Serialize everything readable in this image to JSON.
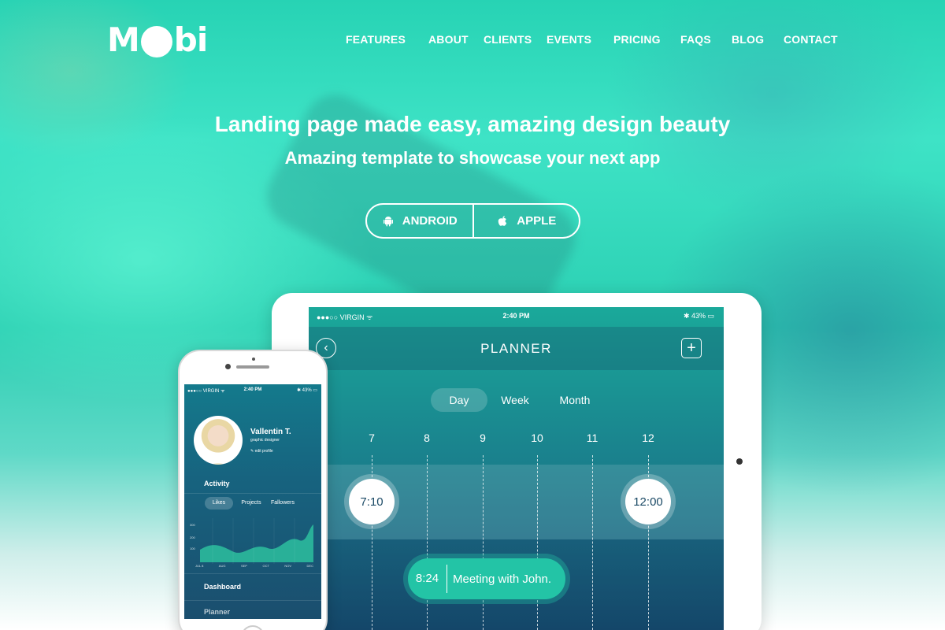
{
  "brand": {
    "logo_left": "M",
    "logo_right": "bi"
  },
  "nav": {
    "items": [
      "FEATURES",
      "ABOUT",
      "CLIENTS",
      "EVENTS",
      "PRICING",
      "FAQS",
      "BLOG",
      "CONTACT"
    ]
  },
  "hero": {
    "title": "Landing page made easy, amazing design beauty",
    "subtitle": "Amazing template to showcase your next app"
  },
  "buttons": {
    "android": "ANDROID",
    "apple": "APPLE"
  },
  "tablet": {
    "status": {
      "carrier": "●●●○○ VIRGIN ᯤ",
      "time": "2:40 PM",
      "battery": "✱ 43% ▭"
    },
    "header": {
      "title": "PLANNER",
      "back_icon": "chevron-left-icon",
      "add_icon": "plus-icon"
    },
    "segments": [
      "Day",
      "Week",
      "Month"
    ],
    "hours": [
      "7",
      "8",
      "9",
      "10",
      "11",
      "12"
    ],
    "events": {
      "start": "7:10",
      "end": "12:00",
      "meeting_time": "8:24",
      "meeting_text": "Meeting with John."
    }
  },
  "phone": {
    "status": {
      "carrier": "●●●○○ VIRGIN ᯤ",
      "time": "2:40 PM",
      "battery": "✱ 43% ▭"
    },
    "profile": {
      "name": "Vallentin T.",
      "role": "graphic designer",
      "edit": "✎ edit profile"
    },
    "activity_title": "Activity",
    "tabs": [
      "Likes",
      "Projects",
      "Fallowers"
    ],
    "chart_axis": [
      "JUL 8",
      "AUG",
      "SEP",
      "OCT",
      "NOV",
      "DEC"
    ],
    "chart_ylabels": [
      "300",
      "200",
      "100"
    ],
    "menu": {
      "dashboard": "Dashboard",
      "planner": "Planner"
    }
  },
  "colors": {
    "accent": "#2ad0b2",
    "meeting": "#23c4a6"
  }
}
